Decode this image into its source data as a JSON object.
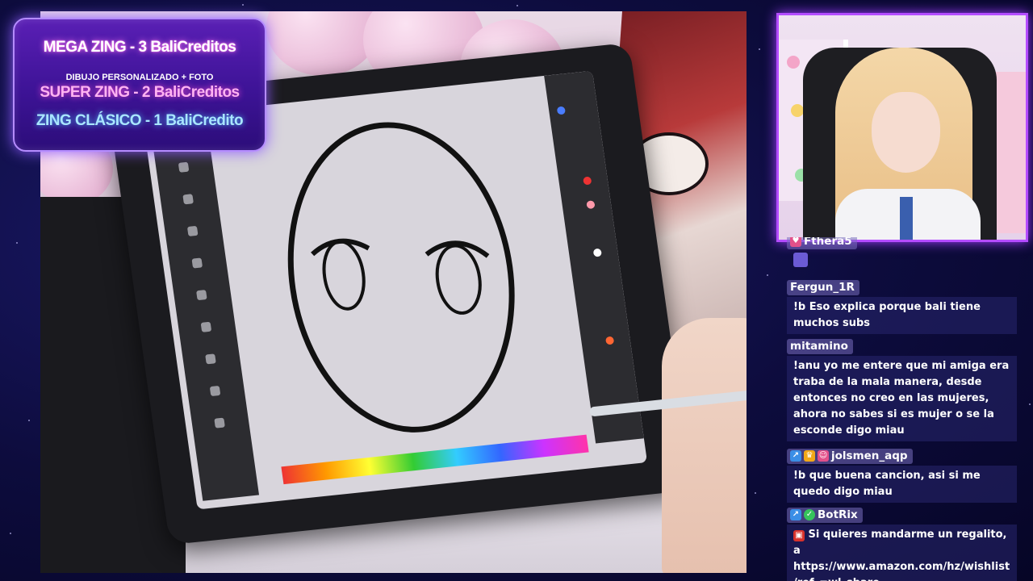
{
  "donation_panel": {
    "mega": "MEGA ZING - 3 BaliCreditos",
    "mega_sub": "DIBUJO PERSONALIZADO + FOTO",
    "super": "SUPER ZING - 2 BaliCreditos",
    "clasico": "ZING CLÁSICO - 1 BaliCredito"
  },
  "chat": {
    "partial_user": "Fthera5",
    "messages": [
      {
        "user": "Fergun_1R",
        "text": "!b Eso explica porque bali tiene muchos subs",
        "badges": []
      },
      {
        "user": "mitamino",
        "text": "!anu yo me entere que mi amiga era traba de la mala manera, desde entonces no creo en las mujeres, ahora no sabes si es mujer o se la esconde digo miau",
        "badges": []
      },
      {
        "user": "jolsmen_aqp",
        "text": "!b que buena cancion, asi si me quedo digo miau",
        "badges": [
          "pin-icon",
          "crown-icon",
          "heart-icon"
        ]
      },
      {
        "user": "BotRix",
        "text": "Si quieres mandarme un regalito, a https://www.amazon.com/hz/wishlist/ref_=wl_share",
        "badges": [
          "pin-icon",
          "verified-icon"
        ]
      }
    ]
  },
  "colors": {
    "accent": "#b44cff",
    "panel": "#3d1396",
    "chat_name_bg": "#786ebe",
    "chat_text_bg": "#28266e"
  }
}
